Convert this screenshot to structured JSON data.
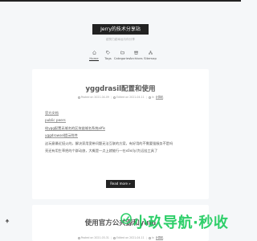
{
  "site": {
    "brand": "Jerry的技术分享站",
    "subtitle": "越努力越幸运与你分享"
  },
  "nav": {
    "items": [
      {
        "label": "Home",
        "icon": "home-icon",
        "active": true
      },
      {
        "label": "Tags",
        "icon": "tag-icon"
      },
      {
        "label": "Categories",
        "icon": "folder-icon"
      },
      {
        "label": "Archives",
        "icon": "archive-icon"
      },
      {
        "label": "Sitemap",
        "icon": "sitemap-icon"
      }
    ]
  },
  "post1": {
    "title": "yggdrasil配置和使用",
    "meta": {
      "posted": "Posted on 2021-04-09",
      "edited": "Edited on 2021-04-11",
      "category_prefix": "In",
      "category": "计算机"
    },
    "body": {
      "link1": "官方文档",
      "link2": "public peers",
      "link3": "给ygg配置无域名的区块链域名系统alfis",
      "link4": "yggdrowsel提示附件",
      "line5": "这玩意最近挺火的，解决家用宽带问题无法互联的方案，有好用的不需要强服务不是吗",
      "line6": "亮还有用生草把的个群动旅，大概是一点上就能行一在x0x(ly)为远挂工具了"
    },
    "readmore": "Read more »"
  },
  "post2": {
    "title": "使用官方公共源和yum",
    "meta": {
      "posted": "Posted on 2021-03-31",
      "edited": "Edited on 2021-04-11",
      "category_prefix": "In",
      "category": "计算机"
    }
  },
  "watermark": "小玖导航·秒收",
  "colors": {
    "accent": "#222222",
    "watermark": "#2fcf6a",
    "background": "#f5f7f9"
  }
}
